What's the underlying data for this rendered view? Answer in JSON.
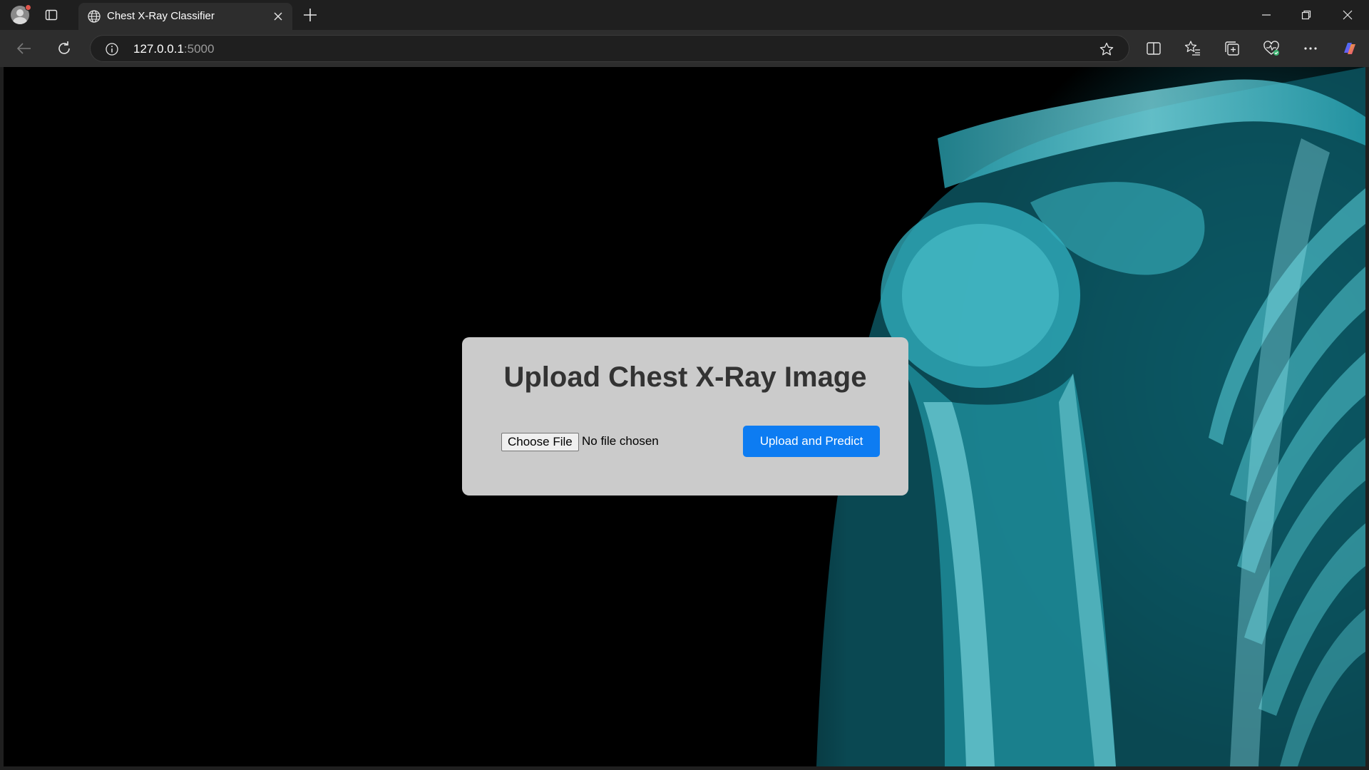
{
  "browser": {
    "tab": {
      "title": "Chest X-Ray Classifier",
      "close_icon": "close-icon",
      "favicon": "globe-icon"
    },
    "new_tab_icon": "plus-icon",
    "window_controls": [
      "minimize-icon",
      "restore-icon",
      "close-icon"
    ],
    "address_bar": {
      "host": "127.0.0.1",
      "port": ":5000"
    },
    "toolbar_icons": [
      "split-screen-icon",
      "favorites-icon",
      "collections-icon",
      "browser-essentials-icon",
      "more-icon",
      "copilot-icon"
    ]
  },
  "page": {
    "heading": "Upload Chest X-Ray Image",
    "file_input": {
      "button_label": "Choose File",
      "status": "No file chosen"
    },
    "submit_label": "Upload and Predict",
    "colors": {
      "card_background": "#cbcbcb",
      "submit_button": "#0d7cf2",
      "heading": "#333333",
      "page_background": "#000000",
      "xray_tint": "#1fa3b3"
    }
  }
}
